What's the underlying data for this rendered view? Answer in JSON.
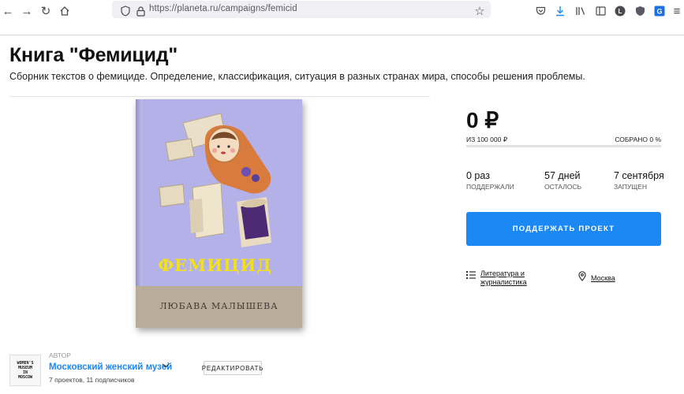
{
  "browser": {
    "url": "https://planeta.ru/campaigns/femicid"
  },
  "campaign": {
    "title": "Книга \"Фемицид\"",
    "subtitle": "Сборник текстов о фемициде. Определение, классификация, ситуация в разных странах мира, способы решения проблемы.",
    "cover_title": "ФЕМИЦИД",
    "cover_author": "ЛЮБАВА МАЛЫШЕВА"
  },
  "funding": {
    "amount": "0 ₽",
    "goal": "ИЗ 100 000 ₽",
    "collected": "СОБРАНО 0 %",
    "progress_fraction": 0
  },
  "stats": [
    {
      "value": "0 раз",
      "label": "ПОДДЕРЖАЛИ"
    },
    {
      "value": "57 дней",
      "label": "ОСТАЛОСЬ"
    },
    {
      "value": "7 сентября",
      "label": "ЗАПУЩЕН"
    }
  ],
  "support_button": "ПОДДЕРЖАТЬ ПРОЕКТ",
  "category": {
    "line1": "Литература и",
    "line2": "журналистика",
    "icon": "list-icon"
  },
  "location": {
    "text": "Москва",
    "icon": "map-pin-icon"
  },
  "author": {
    "label": "АВТОР",
    "name": "Московский женский музей",
    "meta": "7 проектов, 11 подписчиков",
    "logo_lines": [
      "WOMEN'S",
      "MUSEUM",
      "IN",
      "MOSCOW"
    ],
    "edit_label": "РЕДАКТИРОВАТЬ"
  },
  "colors": {
    "accent": "#1b88f4",
    "cover_bg": "#b4b1e9",
    "cover_title": "#f3e01c"
  }
}
